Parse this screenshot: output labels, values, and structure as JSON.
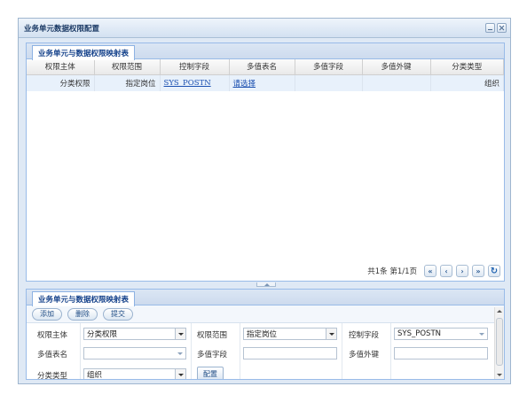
{
  "window": {
    "title": "业务单元数据权限配置"
  },
  "grid_panel": {
    "tab": "业务单元与数据权限映射表",
    "columns": [
      "权限主体",
      "权限范围",
      "控制字段",
      "多值表名",
      "多值字段",
      "多值外键",
      "分类类型"
    ],
    "row": {
      "subject": "分类权限",
      "scope": "指定岗位",
      "control_field": "SYS_POSTN",
      "multi_table": "请选择",
      "multi_field": "",
      "multi_fk": "",
      "category": "组织"
    },
    "pager": {
      "summary": "共1条 第1/1页",
      "first": "«",
      "prev": "‹",
      "next": "›",
      "last": "»",
      "refresh": "↻"
    }
  },
  "form_panel": {
    "tab": "业务单元与数据权限映射表",
    "buttons": {
      "add": "添加",
      "delete": "删除",
      "submit": "提交"
    },
    "labels": {
      "subject": "权限主体",
      "scope": "权限范围",
      "control_field": "控制字段",
      "multi_table": "多值表名",
      "multi_field": "多值字段",
      "multi_fk": "多值外键",
      "category": "分类类型"
    },
    "values": {
      "subject": "分类权限",
      "scope": "指定岗位",
      "control_field": "SYS_POSTN",
      "multi_table": "",
      "multi_field": "",
      "multi_fk": "",
      "category": "组织"
    },
    "config_button": "配置"
  }
}
